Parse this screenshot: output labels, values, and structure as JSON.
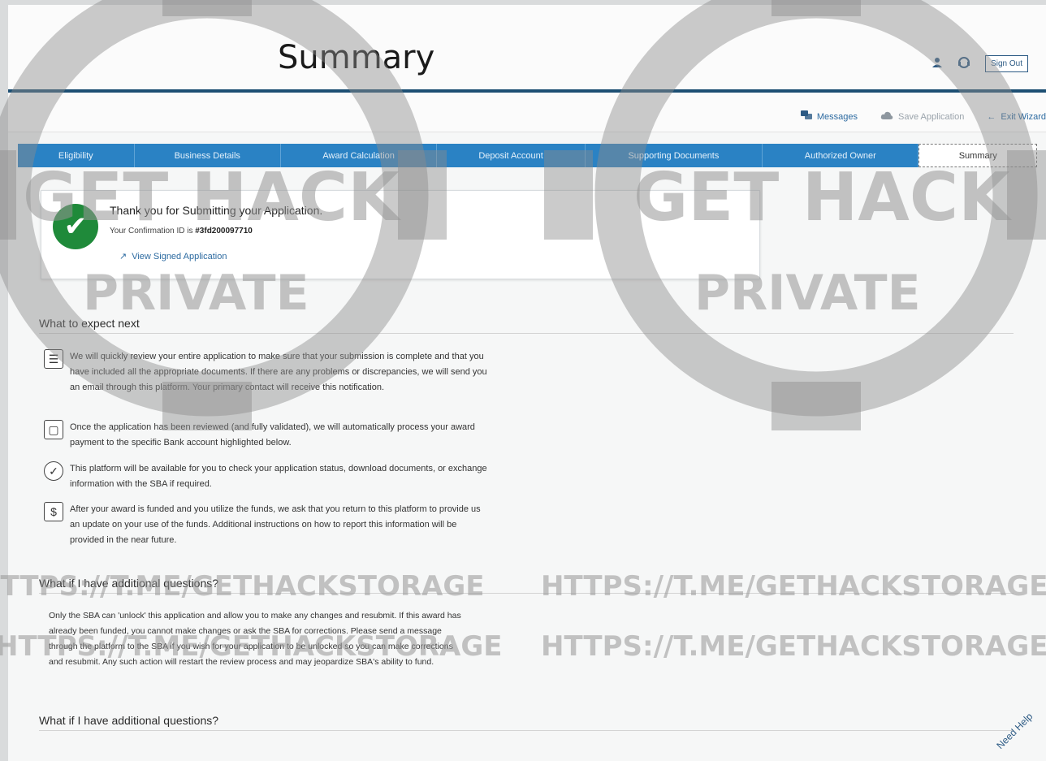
{
  "header": {
    "title": "Summary",
    "user_icon": "user-icon",
    "support_icon": "support-icon",
    "sign_out": "Sign Out"
  },
  "subbar": {
    "messages": "Messages",
    "save": "Save Application",
    "exit": "Exit Wizard"
  },
  "tabs": [
    {
      "label": "Eligibility"
    },
    {
      "label": "Business Details"
    },
    {
      "label": "Award Calculation"
    },
    {
      "label": "Deposit Account"
    },
    {
      "label": "Supporting Documents"
    },
    {
      "label": "Authorized Owner"
    },
    {
      "label": "Summary"
    }
  ],
  "confirmation": {
    "title": "Thank you for Submitting your Application.",
    "id_prefix": "Your Confirmation ID is",
    "id_value": "#3fd200097710",
    "link": "View Signed Application"
  },
  "next": {
    "heading": "What to expect next",
    "items": [
      {
        "icon": "clipboard-icon",
        "text": "We will quickly review your entire application to make sure that your submission is complete and that you have included all the appropriate documents. If there are any problems or discrepancies, we will send you an email through this platform. Your primary contact will receive this notification."
      },
      {
        "icon": "document-icon",
        "text": "Once the application has been reviewed (and fully validated), we will automatically process your award payment to the specific Bank account highlighted below."
      },
      {
        "icon": "badge-check-icon",
        "text": "This platform will be available for you to check your application status, download documents, or exchange information with the SBA if required."
      },
      {
        "icon": "dollar-document-icon",
        "text": "After your award is funded and you utilize the funds, we ask that you return to this platform to provide us an update on your use of the funds. Additional instructions on how to report this information will be provided in the near future."
      }
    ]
  },
  "questions": {
    "heading": "What if I have additional questions?",
    "text": "Only the SBA can 'unlock' this application and allow you to make any changes and resubmit. If this award has already been funded, you cannot make changes or ask the SBA for corrections. Please send a message through the platform to the SBA if you wish for your application to be unlocked so you can make corrections and resubmit. Any such action will restart the review process and may jeopardize SBA's ability to fund.",
    "heading2": "What if I have additional questions?"
  },
  "help": {
    "label": "Need Help"
  },
  "watermark": {
    "big": "GET HACK",
    "small": "PRIVATE",
    "url": "HTTPS://T.ME/GETHACKSTORAGE"
  },
  "colors": {
    "tab_bg": "#2a82c4",
    "brand": "#1d4f73",
    "success": "#1f8a3a"
  }
}
